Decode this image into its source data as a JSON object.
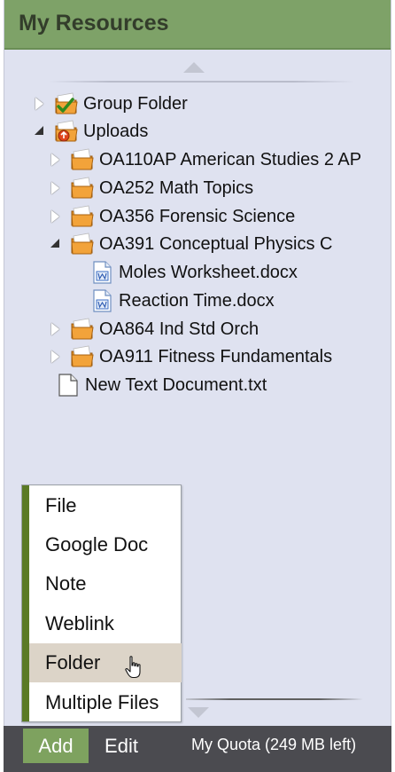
{
  "header": {
    "title": "My Resources"
  },
  "tree": {
    "items": [
      {
        "label": "Group Folder",
        "icon": "group-folder-icon",
        "state": "collapsed"
      },
      {
        "label": "Uploads",
        "icon": "uploads-folder-icon",
        "state": "expanded"
      },
      {
        "label": "OA110AP American Studies 2 AP",
        "icon": "folder-icon",
        "state": "collapsed"
      },
      {
        "label": "OA252 Math Topics",
        "icon": "folder-icon",
        "state": "collapsed"
      },
      {
        "label": "OA356 Forensic Science",
        "icon": "folder-icon",
        "state": "collapsed"
      },
      {
        "label": "OA391 Conceptual Physics C",
        "icon": "folder-icon",
        "state": "expanded"
      },
      {
        "label": "Moles Worksheet.docx",
        "icon": "word-doc-icon",
        "state": "leaf"
      },
      {
        "label": "Reaction Time.docx",
        "icon": "word-doc-icon",
        "state": "leaf"
      },
      {
        "label": "OA864 Ind Std Orch",
        "icon": "folder-icon",
        "state": "collapsed"
      },
      {
        "label": "OA911 Fitness Fundamentals",
        "icon": "folder-icon",
        "state": "collapsed"
      },
      {
        "label": "New Text Document.txt",
        "icon": "text-file-icon",
        "state": "leaf"
      }
    ]
  },
  "add_menu": {
    "items": [
      {
        "label": "File"
      },
      {
        "label": "Google Doc"
      },
      {
        "label": "Note"
      },
      {
        "label": "Weblink"
      },
      {
        "label": "Folder",
        "hovered": true
      },
      {
        "label": "Multiple Files"
      }
    ]
  },
  "footer": {
    "add_label": "Add",
    "edit_label": "Edit",
    "quota_text": "My Quota (249 MB left)"
  },
  "colors": {
    "header_bg": "#7ea268",
    "panel_bg": "#dfe2f0",
    "footer_bg": "#4b4b50",
    "add_button_bg": "#7ea25f",
    "menu_stripe": "#5b7a26",
    "menu_hover": "#dcd4c8",
    "folder_orange": "#f2a33a"
  }
}
